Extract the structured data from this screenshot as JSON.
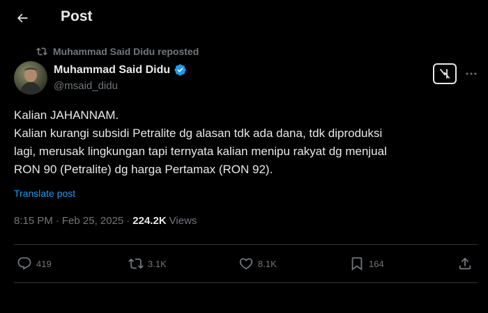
{
  "header": {
    "title": "Post"
  },
  "repost": {
    "text": "Muhammad Said Didu reposted"
  },
  "author": {
    "name": "Muhammad Said Didu",
    "handle": "@msaid_didu"
  },
  "tweet": {
    "lines": [
      "Kalian JAHANNAM.",
      "Kalian kurangi subsidi Petralite dg alasan tdk ada dana, tdk diproduksi",
      "lagi, merusak lingkungan tapi ternyata kalian menipu rakyat dg menjual",
      "RON 90 (Petralite) dg harga Pertamax (RON 92)."
    ],
    "translate_label": "Translate post"
  },
  "meta": {
    "time": "8:15 PM",
    "sep1": "·",
    "date": "Feb 25, 2025",
    "sep2": "·",
    "views_count": "224.2K",
    "views_label": "Views"
  },
  "actions": {
    "replies": "419",
    "reposts": "3.1K",
    "likes": "8.1K",
    "bookmarks": "164"
  },
  "icons": {
    "back": "back-arrow-icon",
    "repost_small": "repost-icon",
    "verified": "verified-badge-icon",
    "grok": "grok-icon",
    "more": "more-icon",
    "reply": "reply-icon",
    "repost": "repost-icon",
    "like": "heart-icon",
    "bookmark": "bookmark-icon",
    "share": "share-icon"
  },
  "colors": {
    "accent": "#1d9bf0",
    "muted": "#71767b",
    "text": "#e7e9ea",
    "background": "#000000"
  }
}
